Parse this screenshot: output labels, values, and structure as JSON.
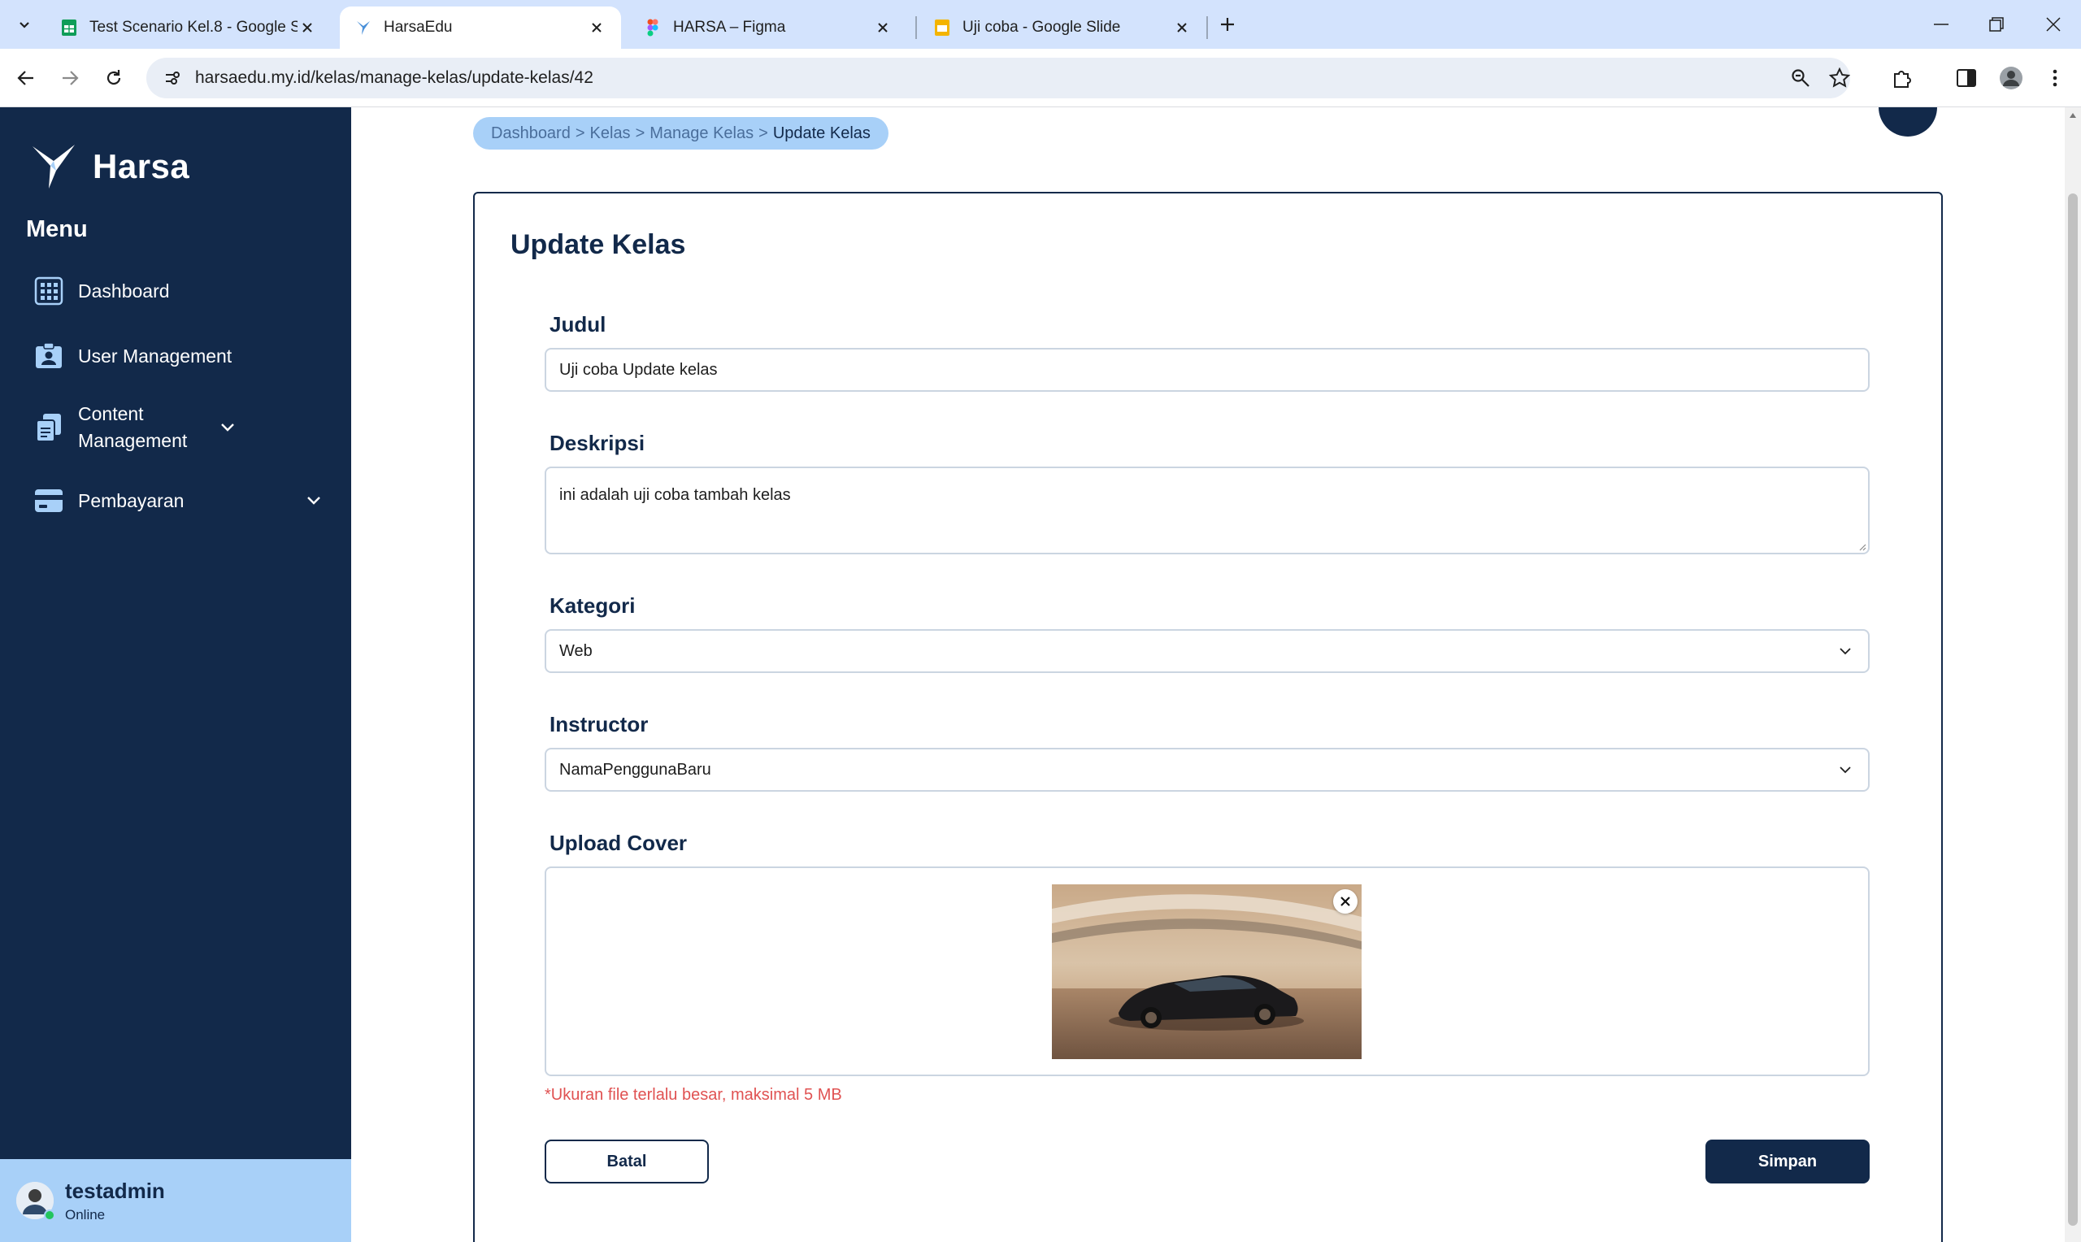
{
  "browser": {
    "tabs": [
      {
        "title": "Test Scenario Kel.8 - Google Sp",
        "favicon": "google-sheets-icon",
        "active": false
      },
      {
        "title": "HarsaEdu",
        "favicon": "harsa-bird-icon",
        "active": true
      },
      {
        "title": "HARSA – Figma",
        "favicon": "figma-icon",
        "active": false
      },
      {
        "title": "Uji coba - Google Slide",
        "favicon": "google-slides-icon",
        "active": false
      }
    ],
    "url": "harsaedu.my.id/kelas/manage-kelas/update-kelas/42"
  },
  "sidebar": {
    "brand": "Harsa",
    "menu_title": "Menu",
    "items": [
      {
        "label": "Dashboard",
        "icon": "grid-icon",
        "expandable": false
      },
      {
        "label": "User Management",
        "icon": "user-card-icon",
        "expandable": false
      },
      {
        "label": "Content Management",
        "icon": "documents-icon",
        "expandable": true
      },
      {
        "label": "Pembayaran",
        "icon": "card-icon",
        "expandable": true
      }
    ],
    "user": {
      "name": "testadmin",
      "status": "Online"
    }
  },
  "breadcrumb": {
    "items": [
      "Dashboard",
      "Kelas",
      "Manage Kelas"
    ],
    "current": "Update Kelas",
    "separator": ">"
  },
  "form": {
    "title": "Update Kelas",
    "judul": {
      "label": "Judul",
      "value": "Uji coba Update kelas"
    },
    "deskripsi": {
      "label": "Deskripsi",
      "value": "ini adalah uji coba tambah kelas"
    },
    "kategori": {
      "label": "Kategori",
      "value": "Web"
    },
    "instructor": {
      "label": "Instructor",
      "value": "NamaPenggunaBaru"
    },
    "upload": {
      "label": "Upload Cover",
      "error": "*Ukuran file terlalu besar, maksimal 5 MB"
    },
    "buttons": {
      "cancel": "Batal",
      "save": "Simpan"
    }
  },
  "colors": {
    "sidebar_bg": "#12294a",
    "accent_light": "#a8d0f8",
    "error": "#e05252",
    "tabstrip": "#d3e3fd"
  }
}
